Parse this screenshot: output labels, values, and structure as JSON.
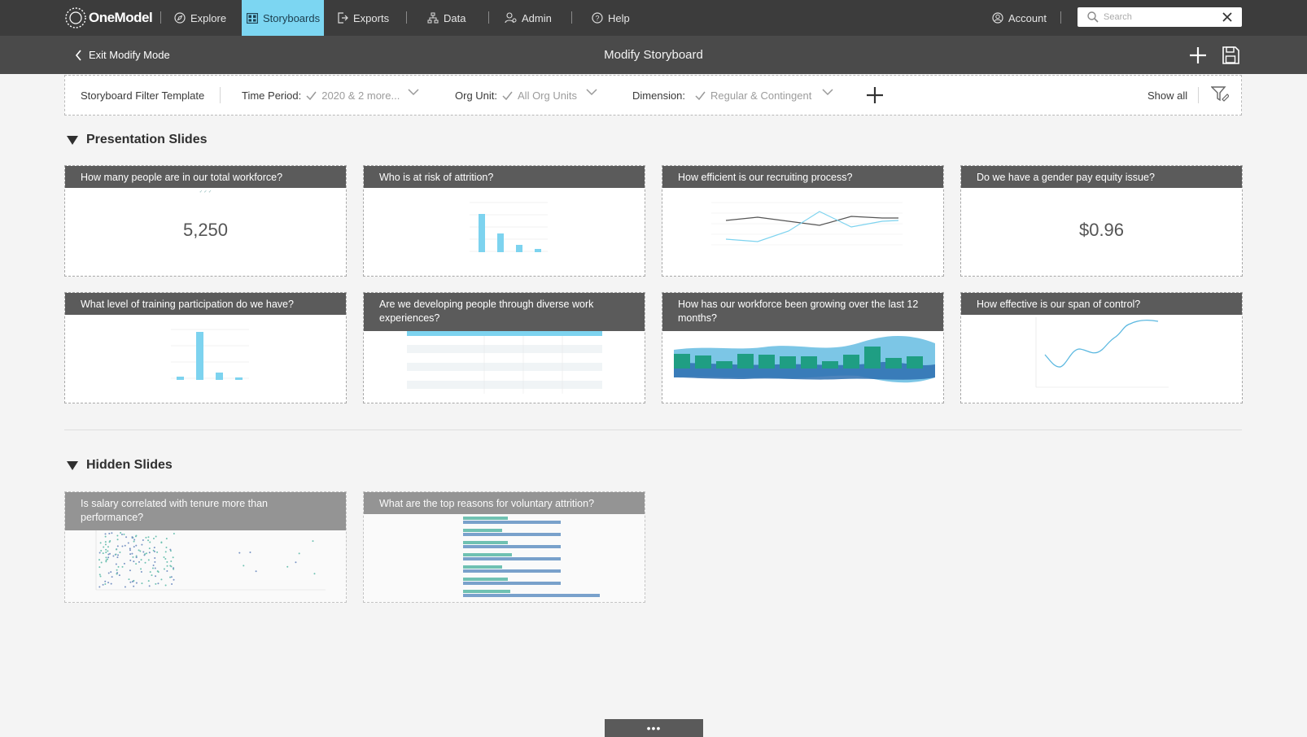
{
  "brand": {
    "logo_text": "OneModel"
  },
  "nav": {
    "explore": "Explore",
    "storyboards": "Storyboards",
    "exports": "Exports",
    "data": "Data",
    "admin": "Admin",
    "help": "Help",
    "account": "Account",
    "search_placeholder": "Search"
  },
  "subheader": {
    "exit": "Exit Modify Mode",
    "title": "Modify Storyboard"
  },
  "filters": {
    "template": "Storyboard Filter Template",
    "time_label": "Time Period:",
    "time_value": "2020 & 2 more...",
    "org_label": "Org Unit:",
    "org_value": "All Org Units",
    "dim_label": "Dimension:",
    "dim_value": "Regular & Contingent",
    "show_all": "Show all"
  },
  "sections": {
    "presentation": "Presentation Slides",
    "hidden": "Hidden Slides"
  },
  "slides": [
    {
      "title": "How many people are in our total workforce?",
      "value": "5,250"
    },
    {
      "title": "Who is at risk of attrition?"
    },
    {
      "title": "How efficient is our recruiting process?"
    },
    {
      "title": "Do we have a gender pay equity issue?",
      "value": "$0.96"
    },
    {
      "title": "What level of training participation do we have?"
    },
    {
      "title": "Are we developing people through diverse work experiences?"
    },
    {
      "title": "How has our workforce been growing over the last 12 months?"
    },
    {
      "title": "How effective is our span of control?"
    }
  ],
  "hidden_slides": [
    {
      "title": "Is salary correlated with tenure more than performance?"
    },
    {
      "title": "What are the top reasons for voluntary attrition?"
    }
  ],
  "more": "•••",
  "colors": {
    "accent": "#7cd6f2",
    "nav_bg": "#3c3c3c",
    "teal": "#1fa38a",
    "blue": "#2f6fb3"
  }
}
